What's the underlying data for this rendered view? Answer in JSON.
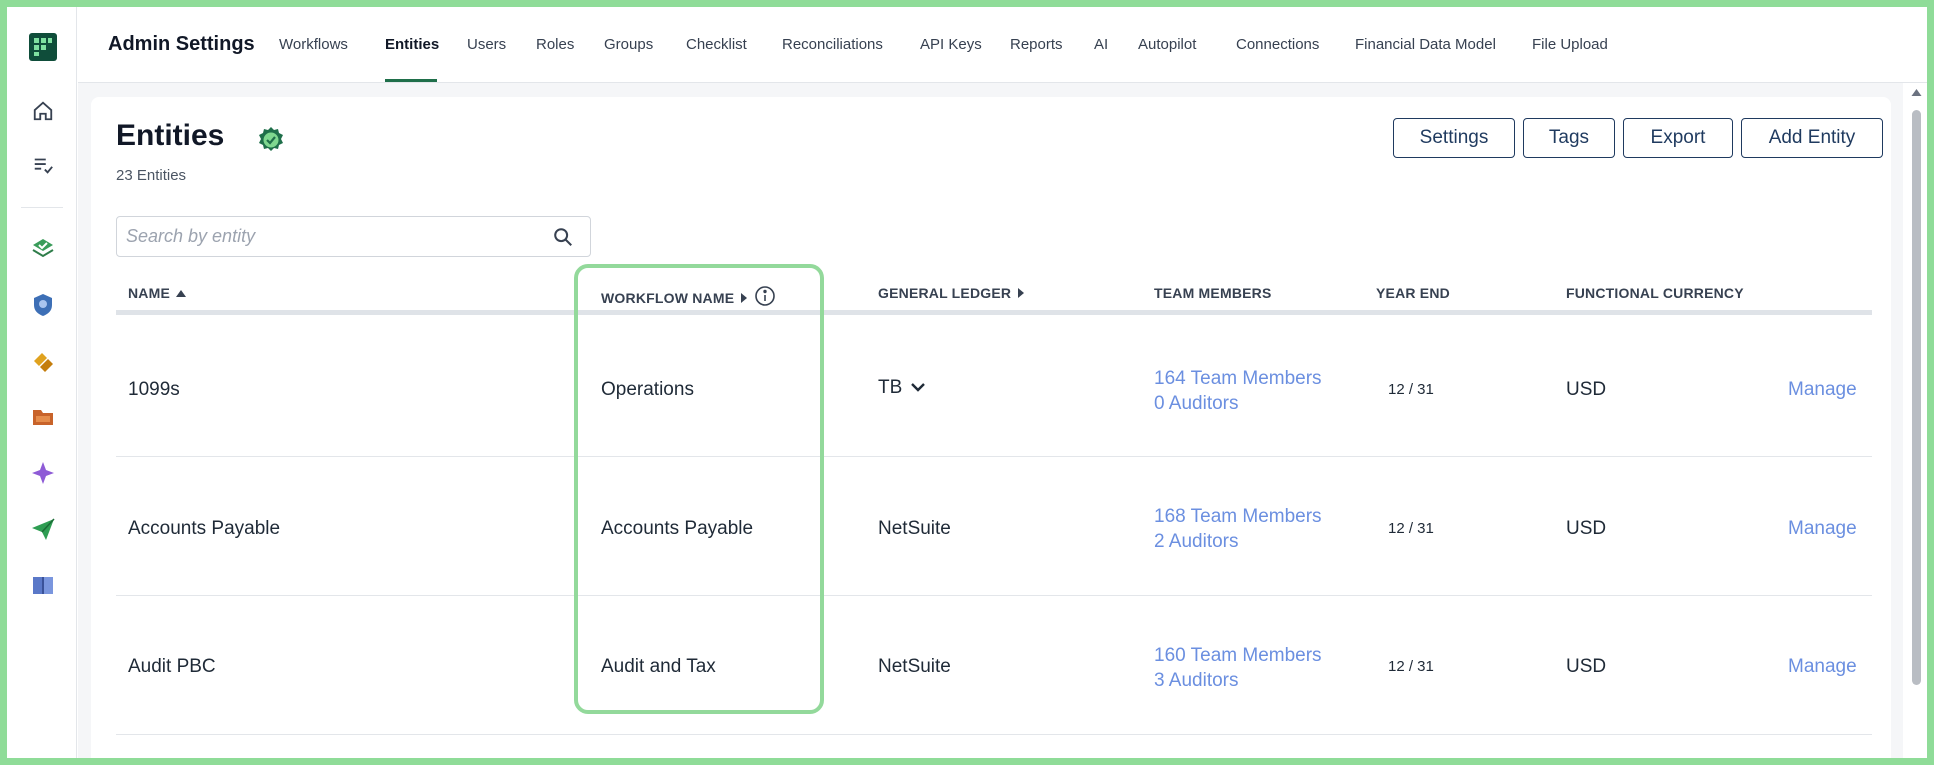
{
  "app": {
    "title": "Admin Settings"
  },
  "nav": {
    "items": [
      {
        "label": "Workflows"
      },
      {
        "label": "Entities",
        "active": true
      },
      {
        "label": "Users"
      },
      {
        "label": "Roles"
      },
      {
        "label": "Groups"
      },
      {
        "label": "Checklist"
      },
      {
        "label": "Reconciliations"
      },
      {
        "label": "API Keys"
      },
      {
        "label": "Reports"
      },
      {
        "label": "AI"
      },
      {
        "label": "Autopilot"
      },
      {
        "label": "Connections"
      },
      {
        "label": "Financial Data Model"
      },
      {
        "label": "File Upload"
      }
    ]
  },
  "sidebar": {
    "icons": [
      "app-logo-icon",
      "home-icon",
      "checklist-icon",
      "stack-check-icon",
      "shield-badge-icon",
      "link-icon",
      "folder-icon",
      "sparkle-icon",
      "paper-plane-icon",
      "book-icon"
    ]
  },
  "page": {
    "title": "Entities",
    "count_text": "23 Entities",
    "buttons": {
      "settings": "Settings",
      "tags": "Tags",
      "export": "Export",
      "add": "Add Entity"
    },
    "search_placeholder": "Search by entity"
  },
  "table": {
    "headers": {
      "name": "NAME",
      "workflow": "WORKFLOW NAME",
      "ledger": "GENERAL LEDGER",
      "team": "TEAM MEMBERS",
      "year_end": "YEAR END",
      "currency": "FUNCTIONAL CURRENCY"
    },
    "rows": [
      {
        "name": "1099s",
        "workflow": "Operations",
        "ledger": "TB",
        "team": "164 Team Members",
        "auditors": "0 Auditors",
        "year_end": "12 / 31",
        "currency": "USD",
        "action": "Manage"
      },
      {
        "name": "Accounts Payable",
        "workflow": "Accounts Payable",
        "ledger": "NetSuite",
        "team": "168 Team Members",
        "auditors": "2 Auditors",
        "year_end": "12 / 31",
        "currency": "USD",
        "action": "Manage"
      },
      {
        "name": "Audit PBC",
        "workflow": "Audit and Tax",
        "ledger": "NetSuite",
        "team": "160 Team Members",
        "auditors": "3 Auditors",
        "year_end": "12 / 31",
        "currency": "USD",
        "action": "Manage"
      }
    ]
  },
  "colors": {
    "accent": "#1f6f4a",
    "link": "#6b8fe0",
    "button_border": "#1f3a5f",
    "highlight": "#93d99b"
  }
}
